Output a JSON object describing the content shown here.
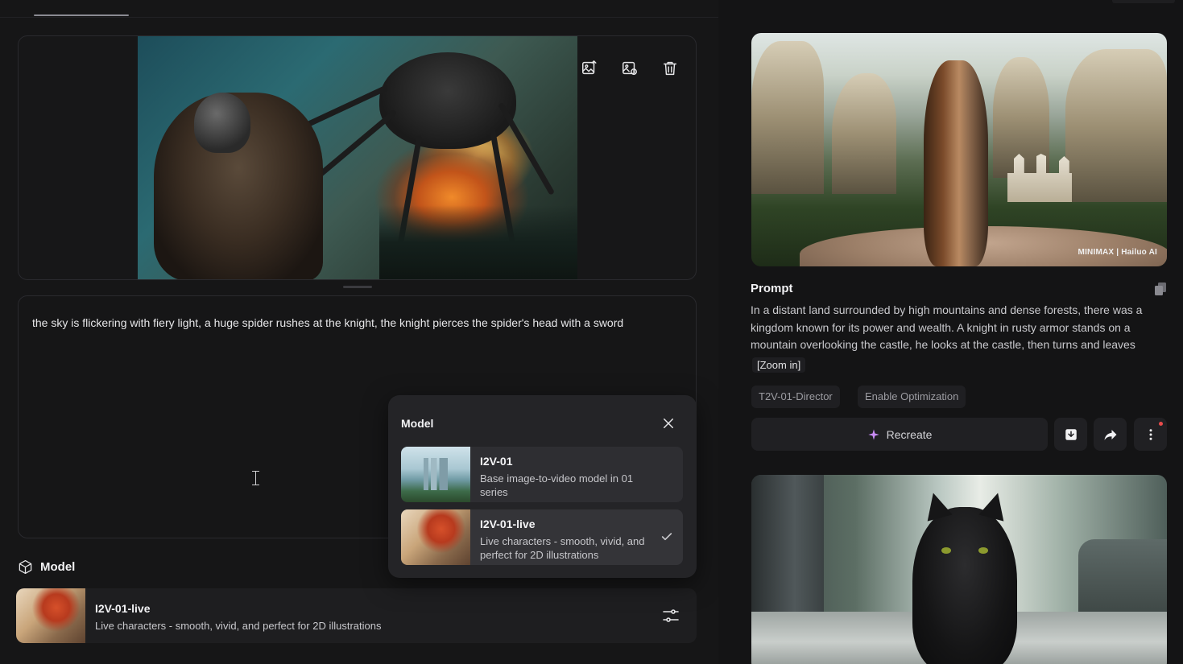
{
  "editor": {
    "prompt_text": "the sky is flickering with fiery light, a huge spider rushes at the knight, the knight pierces the spider's head with a sword",
    "model_section_label": "Model",
    "selected_model": {
      "name": "I2V-01-live",
      "description": "Live characters - smooth, vivid, and perfect for 2D illustrations"
    },
    "image_tools": [
      "replace-image-icon",
      "edit-image-icon",
      "trash-icon"
    ]
  },
  "model_popup": {
    "title": "Model",
    "options": [
      {
        "name": "I2V-01",
        "description": "Base image-to-video model in 01 series",
        "selected": false
      },
      {
        "name": "I2V-01-live",
        "description": "Live characters - smooth, vivid, and perfect for 2D illustrations",
        "selected": true
      }
    ]
  },
  "detail": {
    "watermark": "MINIMAX | Hailuo AI",
    "prompt_label": "Prompt",
    "prompt_body": "In a distant land surrounded by high mountains and dense forests, there was a kingdom known for its power and wealth. A knight in rusty armor stands on a mountain overlooking the castle, he looks at the castle, then turns and leaves",
    "zoom_chip": "[Zoom in]",
    "tags": [
      "T2V-01-Director",
      "Enable Optimization"
    ],
    "recreate_label": "Recreate"
  },
  "colors": {
    "background": "#151516",
    "panel": "#1e1e20",
    "popup": "#242427",
    "notification": "#e84b4b"
  }
}
